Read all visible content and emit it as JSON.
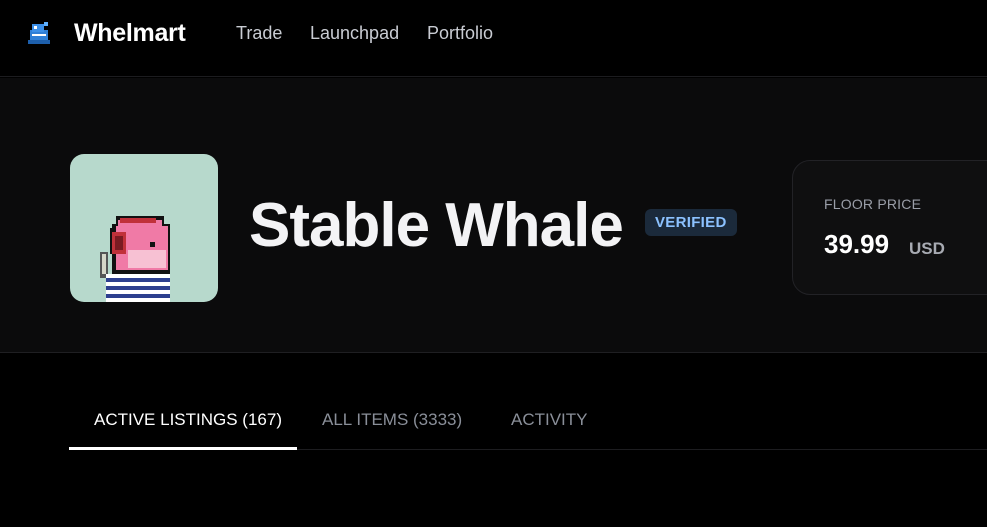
{
  "nav": {
    "brand": "Whelmart",
    "links": [
      "Trade",
      "Launchpad",
      "Portfolio"
    ]
  },
  "collection": {
    "name": "Stable Whale",
    "badge": "VERIFIED",
    "floor": {
      "label": "FLOOR PRICE",
      "value": "39.99",
      "unit": "USD"
    }
  },
  "tabs": [
    "ACTIVE LISTINGS (167)",
    "ALL ITEMS (3333)",
    "ACTIVITY"
  ],
  "active_tab": "ACTIVE LISTINGS (167)",
  "colors": {
    "background": "#000000",
    "hero_background": "#0b0b0c",
    "badge_background": "#1b2a3b",
    "badge_text": "#8cc2ff",
    "avatar_background": "#b7d9cc"
  }
}
